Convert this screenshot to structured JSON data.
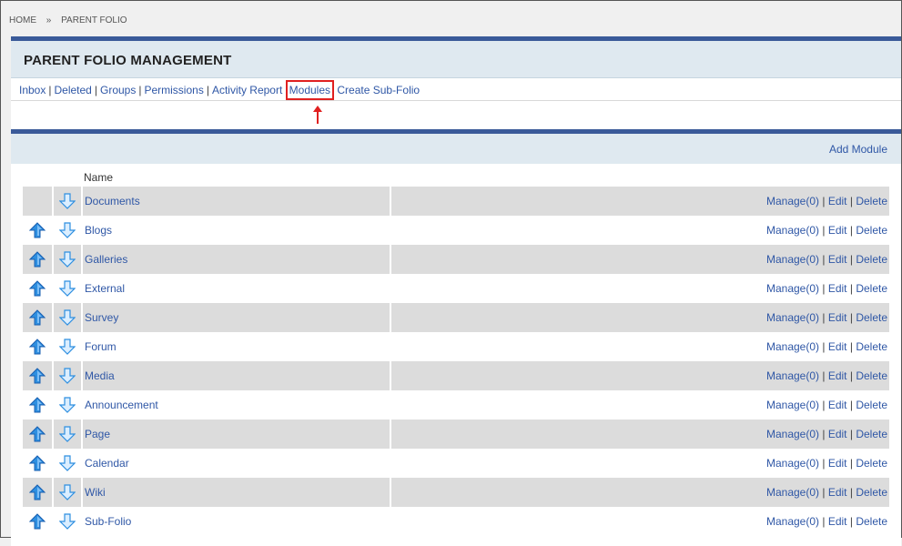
{
  "breadcrumb": {
    "home": "HOME",
    "sep": "»",
    "current": "PARENT FOLIO"
  },
  "header": {
    "title": "PARENT FOLIO MANAGEMENT"
  },
  "tabs": [
    {
      "label": "Inbox"
    },
    {
      "label": "Deleted"
    },
    {
      "label": "Groups"
    },
    {
      "label": "Permissions"
    },
    {
      "label": "Activity Report"
    },
    {
      "label": "Modules"
    },
    {
      "label": "Create Sub-Folio"
    }
  ],
  "section": {
    "add_module": "Add Module",
    "name_header": "Name"
  },
  "actions": {
    "manage": "Manage(0)",
    "edit": "Edit",
    "delete": "Delete",
    "sep": "|"
  },
  "modules": [
    {
      "name": "Documents"
    },
    {
      "name": "Blogs"
    },
    {
      "name": "Galleries"
    },
    {
      "name": "External"
    },
    {
      "name": "Survey"
    },
    {
      "name": "Forum"
    },
    {
      "name": "Media"
    },
    {
      "name": "Announcement"
    },
    {
      "name": "Page"
    },
    {
      "name": "Calendar"
    },
    {
      "name": "Wiki"
    },
    {
      "name": "Sub-Folio"
    }
  ],
  "colors": {
    "accent_bar": "#3a5a99",
    "link": "#2f57a6",
    "highlight": "#e02020",
    "header_bg": "#dfe9f0"
  }
}
